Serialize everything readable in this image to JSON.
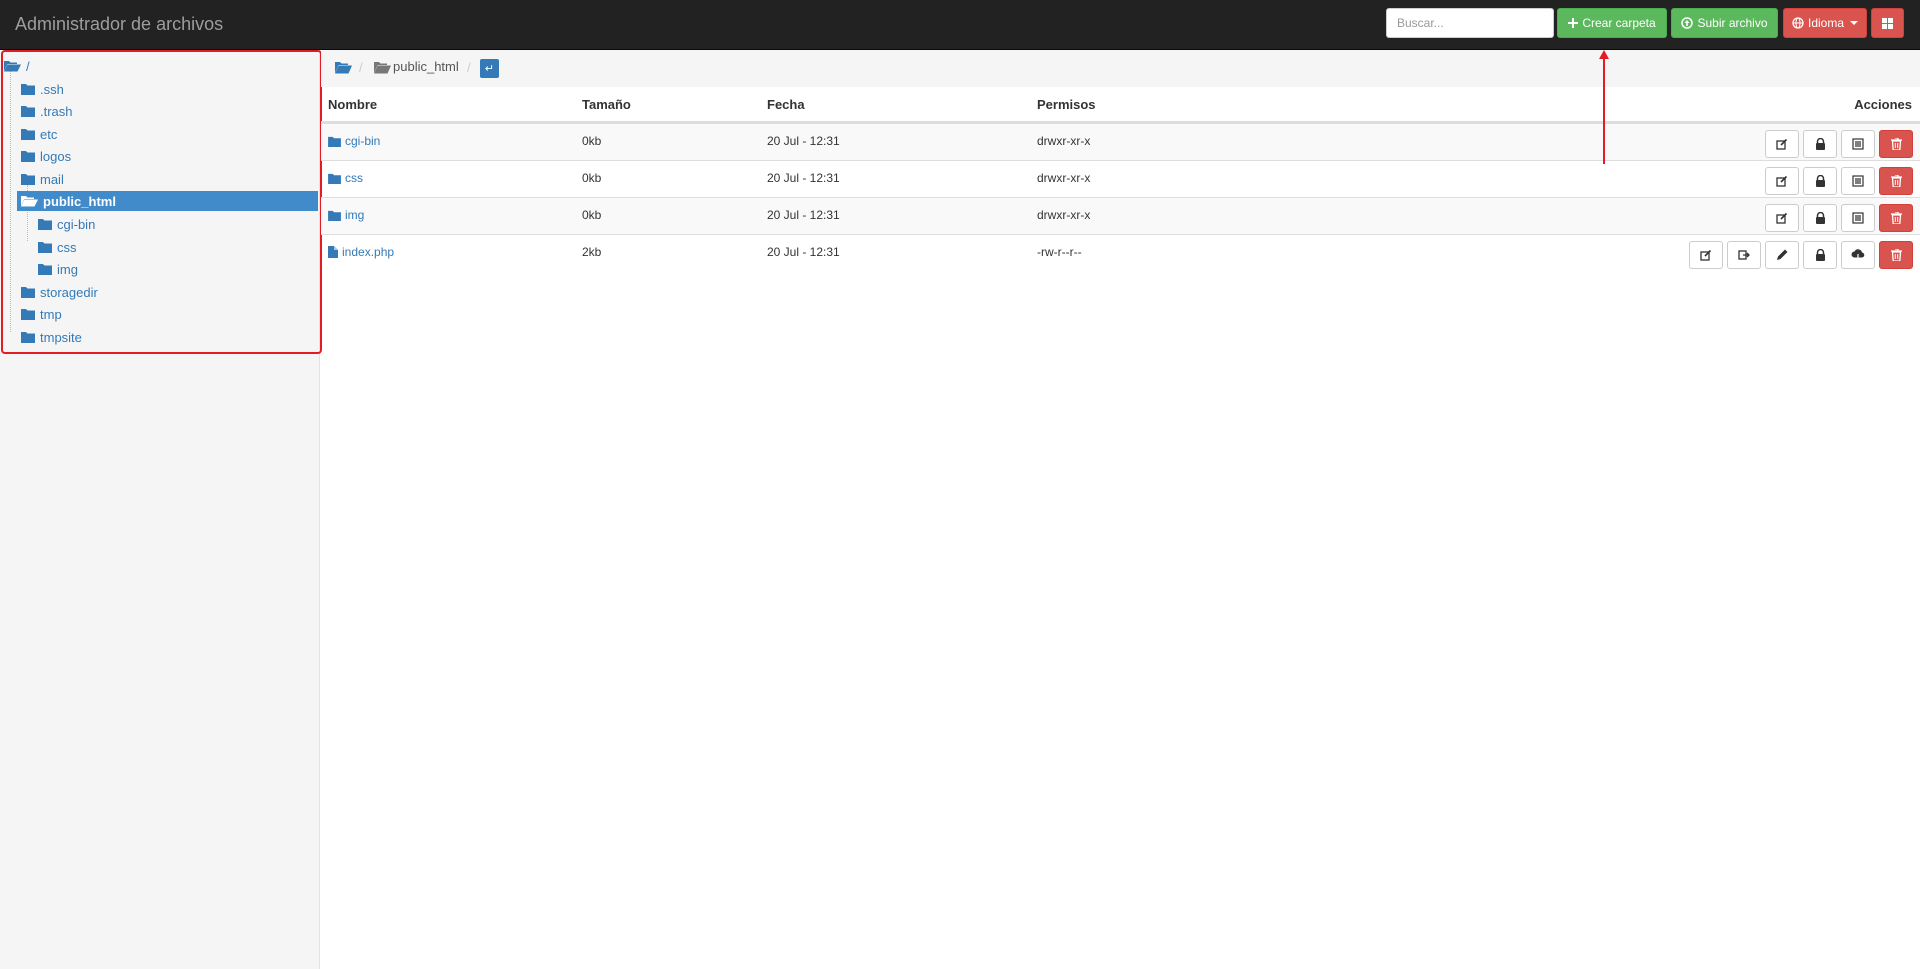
{
  "navbar": {
    "brand": "Administrador de archivos",
    "search_placeholder": "Buscar...",
    "create_folder_label": "Crear carpeta",
    "upload_label": "Subir archivo",
    "language_label": "Idioma"
  },
  "sidebar": {
    "root": "/",
    "items": [
      {
        "label": ".ssh"
      },
      {
        "label": ".trash"
      },
      {
        "label": "etc"
      },
      {
        "label": "logos"
      },
      {
        "label": "mail"
      },
      {
        "label": "public_html"
      },
      {
        "label": "cgi-bin"
      },
      {
        "label": "css"
      },
      {
        "label": "img"
      },
      {
        "label": "storagedir"
      },
      {
        "label": "tmp"
      },
      {
        "label": "tmpsite"
      }
    ]
  },
  "breadcrumb": {
    "sep": "/",
    "current": "public_html",
    "return_glyph": "↵"
  },
  "table": {
    "headers": {
      "name": "Nombre",
      "size": "Tamaño",
      "date": "Fecha",
      "perms": "Permisos",
      "actions": "Acciones"
    },
    "rows": [
      {
        "name": "cgi-bin",
        "size": "0kb",
        "date": "20 Jul - 12:31",
        "perms": "drwxr-xr-x"
      },
      {
        "name": "css",
        "size": "0kb",
        "date": "20 Jul - 12:31",
        "perms": "drwxr-xr-x"
      },
      {
        "name": "img",
        "size": "0kb",
        "date": "20 Jul - 12:31",
        "perms": "drwxr-xr-x"
      },
      {
        "name": "index.php",
        "size": "2kb",
        "date": "20 Jul - 12:31",
        "perms": "-rw-r--r--"
      }
    ]
  },
  "colors": {
    "navbar_bg": "#222222",
    "success": "#5cb85c",
    "danger": "#d9534f",
    "link": "#337ab7",
    "selected": "#428bca",
    "annotation": "#e31b23"
  }
}
